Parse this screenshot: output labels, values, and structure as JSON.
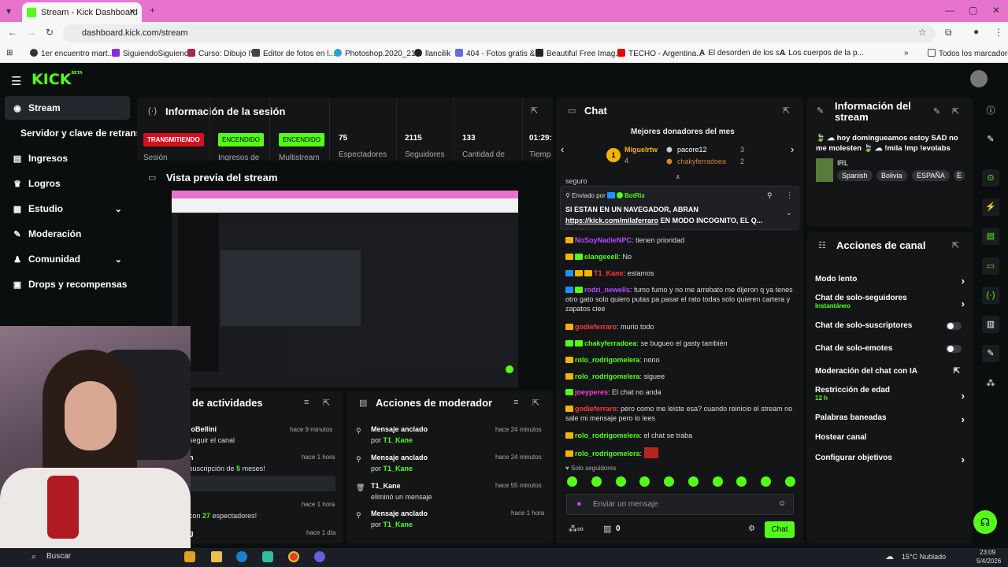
{
  "browser": {
    "tab_title": "Stream - Kick Dashboard",
    "url": "dashboard.kick.com/stream",
    "bookmarks": [
      "1er encuentro mart...",
      "SiguiendoSiguiendo",
      "Curso: Dibujo IV",
      "Editor de fotos en l...",
      "Photoshop.2020_21...",
      "llancilik",
      "404 - Fotos gratis &...",
      "Beautiful Free Imag...",
      "TECHO - Argentina...",
      "El desorden de los s...",
      "Los cuerpos de la p...",
      "Todos los marcadores"
    ]
  },
  "header": {
    "logo": "KICK",
    "beta": "BETA"
  },
  "sidebar": {
    "items": [
      {
        "label": "Stream"
      },
      {
        "label": "Servidor y clave de retransmi"
      },
      {
        "label": "Ingresos"
      },
      {
        "label": "Logros"
      },
      {
        "label": "Estudio"
      },
      {
        "label": "Moderación"
      },
      {
        "label": "Comunidad"
      },
      {
        "label": "Drops y recompensas"
      }
    ]
  },
  "session": {
    "title": "Información de la sesión",
    "stats": [
      {
        "value": "TRANSMITIENDO",
        "label": "Sesión"
      },
      {
        "value": "ENCENDIDO",
        "label": "Ingresos de"
      },
      {
        "value": "ENCENDIDO",
        "label": "Multistream"
      },
      {
        "value": "75",
        "label": "Espectadores"
      },
      {
        "value": "2115",
        "label": "Seguidores"
      },
      {
        "value": "133",
        "label": "Cantidad de"
      },
      {
        "value": "01:29:",
        "label": "Tiemp"
      }
    ]
  },
  "preview": {
    "title": "Vista previa del stream"
  },
  "activity": {
    "title": "de actividades",
    "rows": [
      {
        "name": "loBellini",
        "text": "seguir el canal",
        "time": "hace 9 minutos"
      },
      {
        "name": "h",
        "text": "suscripción de",
        "num": "5",
        "suffix": "meses!",
        "time": "hace 1 hora"
      },
      {
        "name": "",
        "text": "",
        "time": "hace 1 hora"
      },
      {
        "name": "",
        "text": "con",
        "num": "27",
        "suffix": "espectadores!",
        "time": ""
      },
      {
        "name": "g",
        "text": "",
        "time": "hace 1 día"
      }
    ]
  },
  "mod": {
    "title": "Acciones de moderador",
    "rows": [
      {
        "action": "Mensaje anclado",
        "by": "por",
        "user": "T1_Kane",
        "time": "hace 24 minutos"
      },
      {
        "action": "Mensaje anclado",
        "by": "por",
        "user": "T1_Kane",
        "time": "hace 24 minutos"
      },
      {
        "action": "T1_Kane",
        "by": "eliminó un mensaje",
        "user": "",
        "time": "hace 55 minutos"
      },
      {
        "action": "Mensaje anclado",
        "by": "por",
        "user": "T1_Kane",
        "time": "hace 1 hora"
      }
    ]
  },
  "chat": {
    "title": "Chat",
    "donors_title": "Mejores donadores del mes",
    "donors": [
      {
        "rank": "1",
        "name": "Miguelrtw",
        "count": "4"
      },
      {
        "rank": "",
        "name": "pacore12",
        "count": "3"
      },
      {
        "rank": "",
        "name": "chakyferradoea",
        "count": "2"
      }
    ],
    "pinned_by": "Enviado por",
    "pinned_user": "BotRix",
    "pinned_text": "SI ESTAN EN UN NAVEGADOR, ABRAN",
    "pinned_link": "https://kick.com/milaferraro",
    "pinned_rest": "EN MODO INCOGNITO, EL Q...",
    "partial_top": "seguro",
    "messages": [
      {
        "user": "NoSoyNadieNPC",
        "color": "#b44cff",
        "text": "tienen prioridad"
      },
      {
        "user": "elangeeell",
        "color": "#53fc18",
        "text": "No"
      },
      {
        "user": "T1_Kane",
        "color": "#ff3b3b",
        "text": "estamos"
      },
      {
        "user": "rodri_newells",
        "color": "#b44cff",
        "text": "fumo fumo y no me arrebato me dijeron q ya tenes otro gato solo quiero putas pa pasar el rato todas solo quieren cartera y zapatos ciee"
      },
      {
        "user": "godieferraro",
        "color": "#ff3b3b",
        "text": "murio todo"
      },
      {
        "user": "chakyferradoea",
        "color": "#53fc18",
        "text": "se bugueo el gasty también"
      },
      {
        "user": "rolo_rodrigomelera",
        "color": "#53fc18",
        "text": "nono"
      },
      {
        "user": "rolo_rodrigomelera",
        "color": "#53fc18",
        "text": "siguee"
      },
      {
        "user": "joeyperes",
        "color": "#ff3bd4",
        "text": "El chat no anda"
      },
      {
        "user": "godieferraro",
        "color": "#ff3b3b",
        "text": "pero como me leiste esa? cuando reinicio el stream no sale mi mensaje pero lo lees"
      },
      {
        "user": "rolo_rodrigomelera",
        "color": "#53fc18",
        "text": "el chat se traba"
      },
      {
        "user": "rolo_rodrigomelera",
        "color": "#53fc18",
        "text": ""
      }
    ],
    "followers_only": "Solo seguidores",
    "input_placeholder": "Enviar un mensaje",
    "points": "0",
    "send_label": "Chat"
  },
  "stream_info": {
    "title": "Información del stream",
    "stream_title": "🍃 ☁ hoy domingueamos estoy SAD no me molesten 🍃 ☁ !mila !mp !evolabs",
    "category": "IRL",
    "tags": [
      "Spanish",
      "Bolivia",
      "ESPAÑA",
      "E"
    ]
  },
  "channel_actions": {
    "title": "Acciones de canal",
    "items": [
      {
        "label": "Modo lento",
        "sub": "",
        "kind": "arrow"
      },
      {
        "label": "Chat de solo-seguidores",
        "sub": "Instantáneo",
        "kind": "arrow"
      },
      {
        "label": "Chat de solo-suscriptores",
        "sub": "",
        "kind": "toggle"
      },
      {
        "label": "Chat de solo-emotes",
        "sub": "",
        "kind": "toggle"
      },
      {
        "label": "Moderación del chat con IA",
        "sub": "",
        "kind": "external"
      },
      {
        "label": "Restricción de edad",
        "sub": "12 h",
        "kind": "arrow"
      },
      {
        "label": "Palabras baneadas",
        "sub": "",
        "kind": "arrow"
      },
      {
        "label": "Hostear canal",
        "sub": "",
        "kind": "none"
      },
      {
        "label": "Configurar objetivos",
        "sub": "",
        "kind": "arrow"
      }
    ]
  },
  "taskbar": {
    "search": "Buscar",
    "weather": "15°C Nublado",
    "time": "23:09",
    "date": "5/4/2026"
  },
  "colors": {
    "accent": "#53fc18",
    "live": "#d4101f",
    "panel": "#141517",
    "bg": "#0b0e0f"
  }
}
